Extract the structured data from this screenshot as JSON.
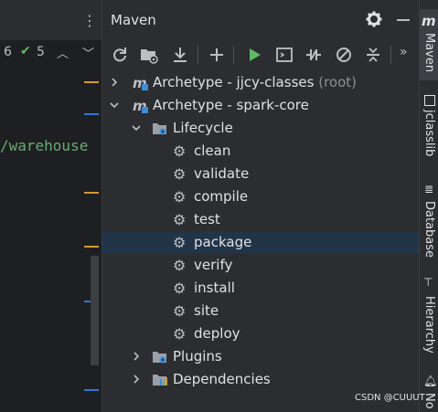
{
  "editor": {
    "count_a": "6",
    "count_b": "5",
    "code_line": "/warehouse"
  },
  "maven": {
    "title": "Maven",
    "tree": [
      {
        "level": 0,
        "expanded": false,
        "icon": "maven-module-icon",
        "label": "Archetype - jjcy-classes",
        "suffix": "(root)"
      },
      {
        "level": 0,
        "expanded": true,
        "icon": "maven-module-icon",
        "label": "Archetype - spark-core",
        "suffix": ""
      },
      {
        "level": 1,
        "expanded": true,
        "icon": "lifecycle-folder-icon",
        "label": "Lifecycle",
        "suffix": ""
      },
      {
        "level": 2,
        "icon": "gear-icon",
        "label": "clean"
      },
      {
        "level": 2,
        "icon": "gear-icon",
        "label": "validate"
      },
      {
        "level": 2,
        "icon": "gear-icon",
        "label": "compile"
      },
      {
        "level": 2,
        "icon": "gear-icon",
        "label": "test"
      },
      {
        "level": 2,
        "icon": "gear-icon",
        "label": "package",
        "selected": true
      },
      {
        "level": 2,
        "icon": "gear-icon",
        "label": "verify"
      },
      {
        "level": 2,
        "icon": "gear-icon",
        "label": "install"
      },
      {
        "level": 2,
        "icon": "gear-icon",
        "label": "site"
      },
      {
        "level": 2,
        "icon": "gear-icon",
        "label": "deploy"
      },
      {
        "level": 1,
        "expanded": false,
        "icon": "plugins-folder-icon",
        "label": "Plugins",
        "suffix": ""
      },
      {
        "level": 1,
        "expanded": false,
        "icon": "dependencies-folder-icon",
        "label": "Dependencies",
        "suffix": ""
      }
    ],
    "toolbar_icons": [
      "reload-icon",
      "add-folder-icon",
      "download-icon",
      "plus-icon",
      "run-icon",
      "execute-goal-icon",
      "toggle-offline-icon",
      "skip-tests-icon",
      "collapse-all-icon",
      "more-icon"
    ]
  },
  "right_tabs": {
    "maven": "Maven",
    "jclasslib": "jclasslib",
    "database": "Database",
    "hierarchy": "Hierarchy",
    "notifications": "No"
  },
  "watermark": "CSDN @CUUUT",
  "colors": {
    "accent_green": "#5fb865",
    "selection": "#213448",
    "maven_blue": "#3d8cd8"
  }
}
